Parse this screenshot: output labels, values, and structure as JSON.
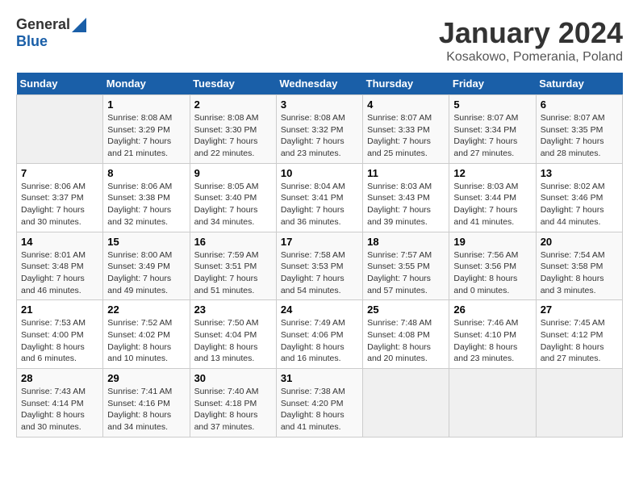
{
  "logo": {
    "line1": "General",
    "line2": "Blue"
  },
  "title": "January 2024",
  "subtitle": "Kosakowo, Pomerania, Poland",
  "days_of_week": [
    "Sunday",
    "Monday",
    "Tuesday",
    "Wednesday",
    "Thursday",
    "Friday",
    "Saturday"
  ],
  "weeks": [
    [
      {
        "num": "",
        "content": ""
      },
      {
        "num": "1",
        "content": "Sunrise: 8:08 AM\nSunset: 3:29 PM\nDaylight: 7 hours\nand 21 minutes."
      },
      {
        "num": "2",
        "content": "Sunrise: 8:08 AM\nSunset: 3:30 PM\nDaylight: 7 hours\nand 22 minutes."
      },
      {
        "num": "3",
        "content": "Sunrise: 8:08 AM\nSunset: 3:32 PM\nDaylight: 7 hours\nand 23 minutes."
      },
      {
        "num": "4",
        "content": "Sunrise: 8:07 AM\nSunset: 3:33 PM\nDaylight: 7 hours\nand 25 minutes."
      },
      {
        "num": "5",
        "content": "Sunrise: 8:07 AM\nSunset: 3:34 PM\nDaylight: 7 hours\nand 27 minutes."
      },
      {
        "num": "6",
        "content": "Sunrise: 8:07 AM\nSunset: 3:35 PM\nDaylight: 7 hours\nand 28 minutes."
      }
    ],
    [
      {
        "num": "7",
        "content": "Sunrise: 8:06 AM\nSunset: 3:37 PM\nDaylight: 7 hours\nand 30 minutes."
      },
      {
        "num": "8",
        "content": "Sunrise: 8:06 AM\nSunset: 3:38 PM\nDaylight: 7 hours\nand 32 minutes."
      },
      {
        "num": "9",
        "content": "Sunrise: 8:05 AM\nSunset: 3:40 PM\nDaylight: 7 hours\nand 34 minutes."
      },
      {
        "num": "10",
        "content": "Sunrise: 8:04 AM\nSunset: 3:41 PM\nDaylight: 7 hours\nand 36 minutes."
      },
      {
        "num": "11",
        "content": "Sunrise: 8:03 AM\nSunset: 3:43 PM\nDaylight: 7 hours\nand 39 minutes."
      },
      {
        "num": "12",
        "content": "Sunrise: 8:03 AM\nSunset: 3:44 PM\nDaylight: 7 hours\nand 41 minutes."
      },
      {
        "num": "13",
        "content": "Sunrise: 8:02 AM\nSunset: 3:46 PM\nDaylight: 7 hours\nand 44 minutes."
      }
    ],
    [
      {
        "num": "14",
        "content": "Sunrise: 8:01 AM\nSunset: 3:48 PM\nDaylight: 7 hours\nand 46 minutes."
      },
      {
        "num": "15",
        "content": "Sunrise: 8:00 AM\nSunset: 3:49 PM\nDaylight: 7 hours\nand 49 minutes."
      },
      {
        "num": "16",
        "content": "Sunrise: 7:59 AM\nSunset: 3:51 PM\nDaylight: 7 hours\nand 51 minutes."
      },
      {
        "num": "17",
        "content": "Sunrise: 7:58 AM\nSunset: 3:53 PM\nDaylight: 7 hours\nand 54 minutes."
      },
      {
        "num": "18",
        "content": "Sunrise: 7:57 AM\nSunset: 3:55 PM\nDaylight: 7 hours\nand 57 minutes."
      },
      {
        "num": "19",
        "content": "Sunrise: 7:56 AM\nSunset: 3:56 PM\nDaylight: 8 hours\nand 0 minutes."
      },
      {
        "num": "20",
        "content": "Sunrise: 7:54 AM\nSunset: 3:58 PM\nDaylight: 8 hours\nand 3 minutes."
      }
    ],
    [
      {
        "num": "21",
        "content": "Sunrise: 7:53 AM\nSunset: 4:00 PM\nDaylight: 8 hours\nand 6 minutes."
      },
      {
        "num": "22",
        "content": "Sunrise: 7:52 AM\nSunset: 4:02 PM\nDaylight: 8 hours\nand 10 minutes."
      },
      {
        "num": "23",
        "content": "Sunrise: 7:50 AM\nSunset: 4:04 PM\nDaylight: 8 hours\nand 13 minutes."
      },
      {
        "num": "24",
        "content": "Sunrise: 7:49 AM\nSunset: 4:06 PM\nDaylight: 8 hours\nand 16 minutes."
      },
      {
        "num": "25",
        "content": "Sunrise: 7:48 AM\nSunset: 4:08 PM\nDaylight: 8 hours\nand 20 minutes."
      },
      {
        "num": "26",
        "content": "Sunrise: 7:46 AM\nSunset: 4:10 PM\nDaylight: 8 hours\nand 23 minutes."
      },
      {
        "num": "27",
        "content": "Sunrise: 7:45 AM\nSunset: 4:12 PM\nDaylight: 8 hours\nand 27 minutes."
      }
    ],
    [
      {
        "num": "28",
        "content": "Sunrise: 7:43 AM\nSunset: 4:14 PM\nDaylight: 8 hours\nand 30 minutes."
      },
      {
        "num": "29",
        "content": "Sunrise: 7:41 AM\nSunset: 4:16 PM\nDaylight: 8 hours\nand 34 minutes."
      },
      {
        "num": "30",
        "content": "Sunrise: 7:40 AM\nSunset: 4:18 PM\nDaylight: 8 hours\nand 37 minutes."
      },
      {
        "num": "31",
        "content": "Sunrise: 7:38 AM\nSunset: 4:20 PM\nDaylight: 8 hours\nand 41 minutes."
      },
      {
        "num": "",
        "content": ""
      },
      {
        "num": "",
        "content": ""
      },
      {
        "num": "",
        "content": ""
      }
    ]
  ]
}
